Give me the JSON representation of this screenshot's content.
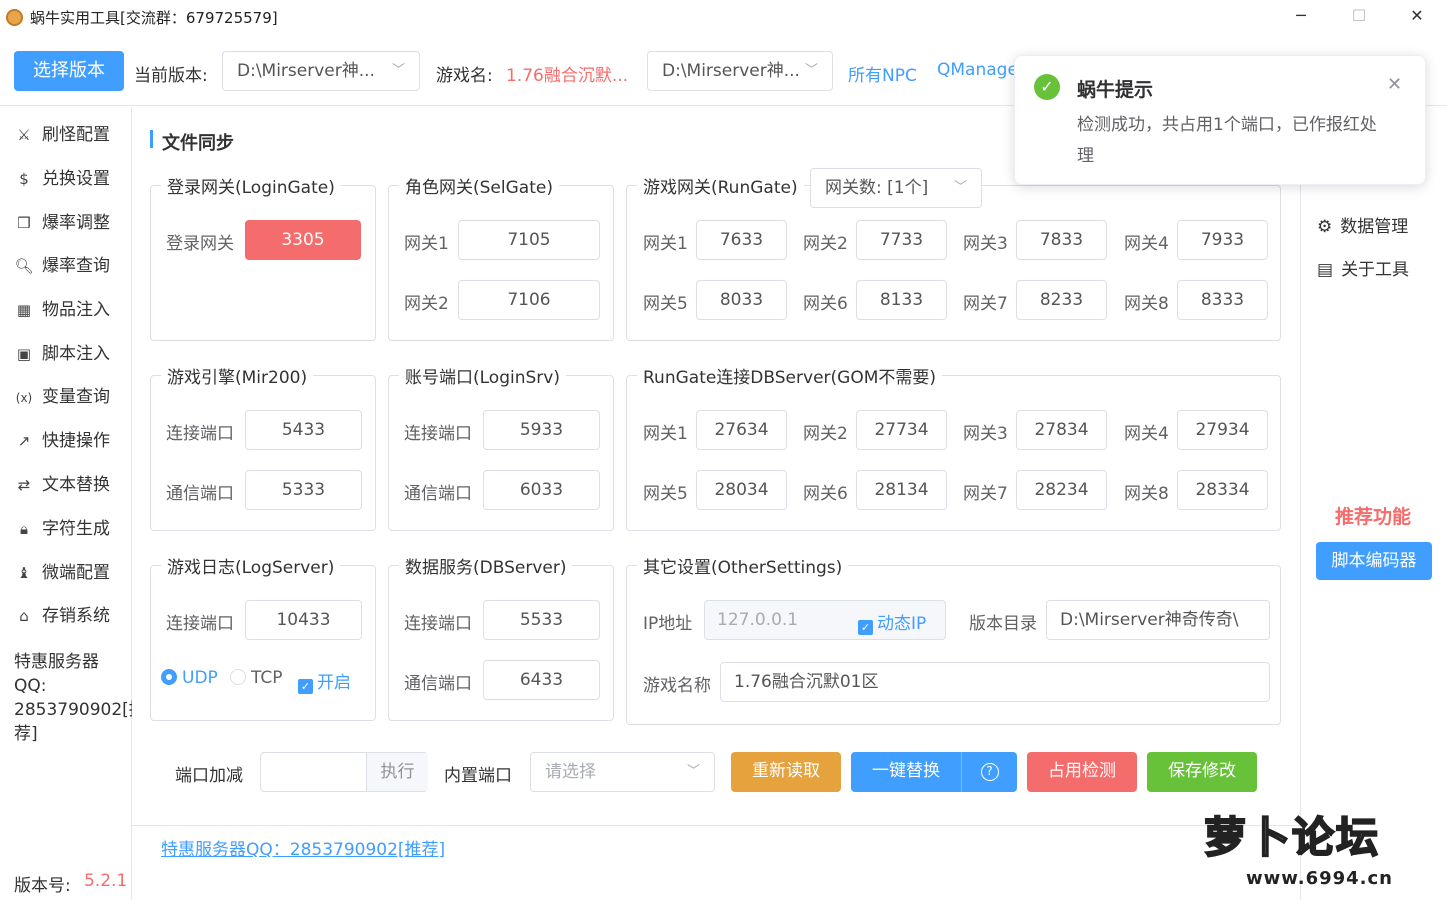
{
  "titlebar": {
    "title": "蜗牛实用工具[交流群：679725579]",
    "minimize": "─",
    "maximize": "☐",
    "close": "✕"
  },
  "topbar": {
    "select_version_btn": "选择版本",
    "current_version_label": "当前版本:",
    "current_version_value": "D:\\Mirserver神...",
    "game_name_label": "游戏名:",
    "game_name_value": "1.76融合沉默...",
    "path_select_value": "D:\\Mirserver神...",
    "link_npc": "所有NPC",
    "link_qmanage": "QManage"
  },
  "sidebar": {
    "items": [
      {
        "icon": "monster-icon",
        "glyph": "⚔",
        "label": "刷怪配置"
      },
      {
        "icon": "dollar-icon",
        "glyph": "$",
        "label": "兑换设置"
      },
      {
        "icon": "cube-icon",
        "glyph": "❒",
        "label": "爆率调整"
      },
      {
        "icon": "search-icon",
        "glyph": "🔍︎",
        "label": "爆率查询"
      },
      {
        "icon": "grid-icon",
        "glyph": "▦",
        "label": "物品注入"
      },
      {
        "icon": "terminal-icon",
        "glyph": "▣",
        "label": "脚本注入"
      },
      {
        "icon": "variable-icon",
        "glyph": "(x)",
        "label": "变量查询"
      },
      {
        "icon": "external-link-icon",
        "glyph": "↗",
        "label": "快捷操作"
      },
      {
        "icon": "replace-icon",
        "glyph": "⇄",
        "label": "文本替换"
      },
      {
        "icon": "lock-icon",
        "glyph": "🔒︎",
        "label": "字符生成"
      },
      {
        "icon": "chess-icon",
        "glyph": "♝",
        "label": "微端配置"
      },
      {
        "icon": "store-icon",
        "glyph": "⌂",
        "label": "存销系统"
      }
    ],
    "promo_line1": "特惠服务器",
    "promo_line2": "QQ:",
    "promo_line3": "2853790902[推",
    "promo_line4": "荐]",
    "version_label": "版本号:",
    "version_value": "5.2.1"
  },
  "section_title": "文件同步",
  "logingate": {
    "legend": "登录网关(LoginGate)",
    "label": "登录网关",
    "value": "3305"
  },
  "selgate": {
    "legend": "角色网关(SelGate)",
    "label1": "网关1",
    "value1": "7105",
    "label2": "网关2",
    "value2": "7106"
  },
  "rungate": {
    "legend": "游戏网关(RunGate)",
    "count_select": "网关数: [1个]",
    "gates": [
      {
        "label": "网关1",
        "value": "7633"
      },
      {
        "label": "网关2",
        "value": "7733"
      },
      {
        "label": "网关3",
        "value": "7833"
      },
      {
        "label": "网关4",
        "value": "7933"
      },
      {
        "label": "网关5",
        "value": "8033"
      },
      {
        "label": "网关6",
        "value": "8133"
      },
      {
        "label": "网关7",
        "value": "8233"
      },
      {
        "label": "网关8",
        "value": "8333"
      }
    ]
  },
  "mir200": {
    "legend": "游戏引擎(Mir200)",
    "label1": "连接端口",
    "value1": "5433",
    "label2": "通信端口",
    "value2": "5333"
  },
  "loginsrv": {
    "legend": "账号端口(LoginSrv)",
    "label1": "连接端口",
    "value1": "5933",
    "label2": "通信端口",
    "value2": "6033"
  },
  "dbconn": {
    "legend": "RunGate连接DBServer(GOM不需要)",
    "gates": [
      {
        "label": "网关1",
        "value": "27634"
      },
      {
        "label": "网关2",
        "value": "27734"
      },
      {
        "label": "网关3",
        "value": "27834"
      },
      {
        "label": "网关4",
        "value": "27934"
      },
      {
        "label": "网关5",
        "value": "28034"
      },
      {
        "label": "网关6",
        "value": "28134"
      },
      {
        "label": "网关7",
        "value": "28234"
      },
      {
        "label": "网关8",
        "value": "28334"
      }
    ]
  },
  "logserver": {
    "legend": "游戏日志(LogServer)",
    "label1": "连接端口",
    "value1": "10433",
    "udp": "UDP",
    "tcp": "TCP",
    "enable": "开启"
  },
  "dbserver": {
    "legend": "数据服务(DBServer)",
    "label1": "连接端口",
    "value1": "5533",
    "label2": "通信端口",
    "value2": "6433"
  },
  "other": {
    "legend": "其它设置(OtherSettings)",
    "ip_label": "IP地址",
    "ip_value": "127.0.0.1",
    "dynamic_ip": "动态IP",
    "dir_label": "版本目录",
    "dir_value": "D:\\Mirserver神奇传奇\\",
    "name_label": "游戏名称",
    "name_value": "1.76融合沉默01区"
  },
  "actions": {
    "port_add_label": "端口加减",
    "exec": "执行",
    "builtin_port_label": "内置端口",
    "builtin_placeholder": "请选择",
    "reload": "重新读取",
    "replace": "一键替换",
    "help": "?",
    "occupy": "占用检测",
    "save": "保存修改"
  },
  "footer_link": "特惠服务器QQ：2853790902[推荐]",
  "rightpanel": {
    "data_mgmt": "数据管理",
    "about": "关于工具",
    "recommend": "推荐功能",
    "encoder": "脚本编码器"
  },
  "toast": {
    "title": "蜗牛提示",
    "message": "检测成功，共占用1个端口，已作报红处理"
  },
  "watermark": {
    "text": "www.6994.cn",
    "brand": "萝卜论坛"
  },
  "colors": {
    "primary": "#409eff",
    "danger": "#f56c6c",
    "warning": "#e6a23c",
    "success": "#67c23a"
  }
}
